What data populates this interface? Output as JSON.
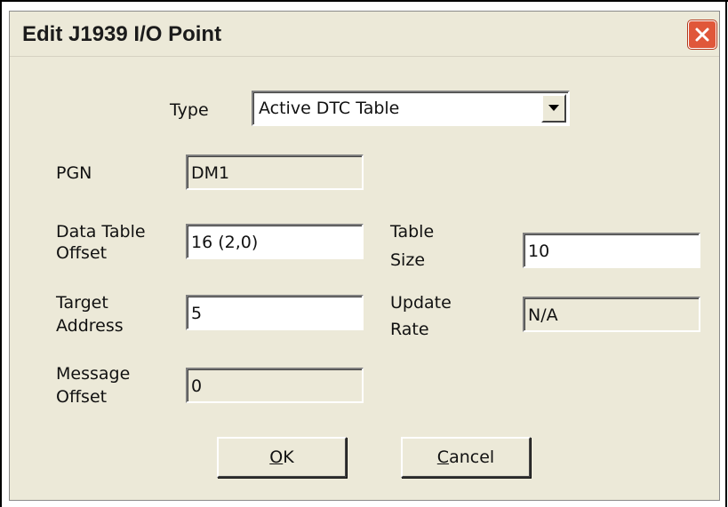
{
  "dialog": {
    "title": "Edit J1939 I/O Point",
    "close_icon": "close-x-icon"
  },
  "type": {
    "label": "Type",
    "selected": "Active DTC Table"
  },
  "pgn": {
    "label": "PGN",
    "value": "DM1"
  },
  "data_table_offset": {
    "label_line1": "Data Table",
    "label_line2": "Offset",
    "value": "16 (2,0)"
  },
  "table_size": {
    "label_line1": "Table",
    "label_line2": "Size",
    "value": "10"
  },
  "target_address": {
    "label_line1": "Target",
    "label_line2": "Address",
    "value": "5"
  },
  "update_rate": {
    "label_line1": "Update",
    "label_line2": "Rate",
    "value": "N/A"
  },
  "message_offset": {
    "label_line1": "Message",
    "label_line2": "Offset",
    "value": "0"
  },
  "buttons": {
    "ok": {
      "mnemonic": "O",
      "rest": "K"
    },
    "cancel": {
      "mnemonic": "C",
      "rest": "ancel"
    }
  },
  "colors": {
    "dialog_bg": "#ece9d8",
    "close_button": "#e0573a"
  }
}
